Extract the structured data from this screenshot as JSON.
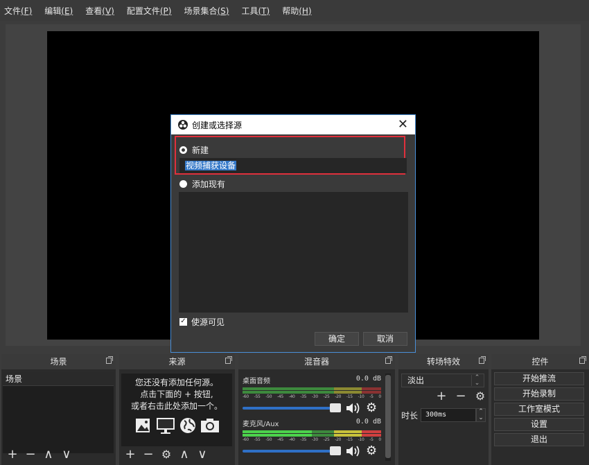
{
  "menu": [
    {
      "label": "文件",
      "key": "(F)"
    },
    {
      "label": "编辑",
      "key": "(E)"
    },
    {
      "label": "查看",
      "key": "(V)"
    },
    {
      "label": "配置文件",
      "key": "(P)"
    },
    {
      "label": "场景集合",
      "key": "(S)"
    },
    {
      "label": "工具",
      "key": "(T)"
    },
    {
      "label": "帮助",
      "key": "(H)"
    }
  ],
  "docks": {
    "scenes": {
      "title": "场景",
      "items": [
        "场景"
      ]
    },
    "sources": {
      "title": "来源",
      "empty_line1": "您还没有添加任何源。",
      "empty_line2": "点击下面的 + 按钮,",
      "empty_line3": "或者右击此处添加一个。"
    },
    "mixer": {
      "title": "混音器",
      "channels": [
        {
          "name": "桌面音频",
          "db": "0.0 dB"
        },
        {
          "name": "麦克风/Aux",
          "db": "0.0 dB"
        }
      ],
      "scale": [
        "-60",
        "-55",
        "-50",
        "-45",
        "-40",
        "-35",
        "-30",
        "-25",
        "-20",
        "-15",
        "-10",
        "-5",
        "0"
      ]
    },
    "transitions": {
      "title": "转场特效",
      "selected": "淡出",
      "duration_label": "时长",
      "duration_value": "300ms"
    },
    "controls": {
      "title": "控件",
      "buttons": [
        "开始推流",
        "开始录制",
        "工作室模式",
        "设置",
        "退出"
      ]
    }
  },
  "dialog": {
    "title": "创建或选择源",
    "close": "✕",
    "new_label": "新建",
    "name_value": "视频捕获设备",
    "existing_label": "添加现有",
    "visible_label": "使源可见",
    "visible_checked": true,
    "ok": "确定",
    "cancel": "取消"
  },
  "colors": {
    "highlight": "#e0303c",
    "accent": "#3478c8",
    "slider": "#2f70c6"
  }
}
